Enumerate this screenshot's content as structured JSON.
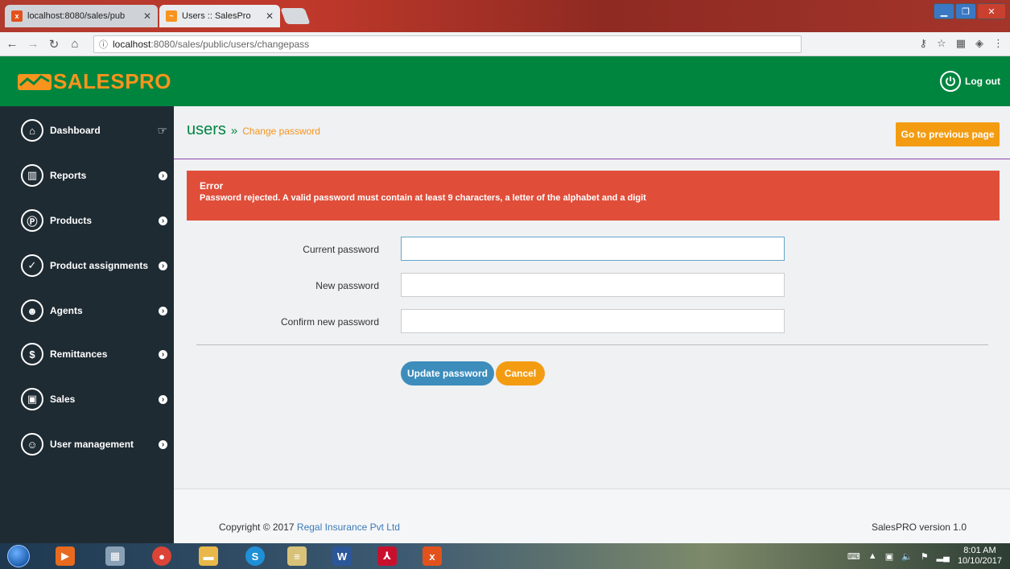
{
  "browser": {
    "tabs": [
      {
        "title": "localhost:8080/sales/pub",
        "active": false
      },
      {
        "title": "Users :: SalesPro",
        "active": true
      }
    ],
    "url_host": "localhost",
    "url_rest": ":8080/sales/public/users/changepass",
    "info_icon": "ⓘ"
  },
  "header": {
    "brand_part1": "SALES",
    "brand_part2": "PRO",
    "logout_label": "Log out"
  },
  "sidebar": {
    "items": [
      {
        "label": "Dashboard",
        "icon": "home-icon"
      },
      {
        "label": "Reports",
        "icon": "chart-icon"
      },
      {
        "label": "Products",
        "icon": "product-icon"
      },
      {
        "label": "Product assignments",
        "icon": "check-icon"
      },
      {
        "label": "Agents",
        "icon": "agents-icon"
      },
      {
        "label": "Remittances",
        "icon": "dollar-icon"
      },
      {
        "label": "Sales",
        "icon": "cash-icon"
      },
      {
        "label": "User management",
        "icon": "user-icon"
      }
    ]
  },
  "main": {
    "breadcrumb_root": "users",
    "breadcrumb_sep": "»",
    "breadcrumb_leaf": "Change password",
    "prev_button": "Go to previous page",
    "alert_title": "Error",
    "alert_message": "Password rejected. A valid password must contain at least 9 characters, a letter of the alphabet and a digit",
    "fields": {
      "current_label": "Current password",
      "current_value": "",
      "new_label": "New password",
      "new_value": "",
      "confirm_label": "Confirm new password",
      "confirm_value": ""
    },
    "update_button": "Update password",
    "cancel_button": "Cancel"
  },
  "footer": {
    "copy_prefix": "Copyright © 2017 ",
    "company": "Regal Insurance Pvt Ltd",
    "version": "SalesPRO version 1.0"
  },
  "taskbar": {
    "time": "8:01 AM",
    "date": "10/10/2017"
  },
  "colors": {
    "header_green": "#00853f",
    "sidebar_dark": "#1f2b33",
    "accent_orange": "#f39c12",
    "alert_red": "#e04e3a",
    "primary_blue": "#3c8dbc"
  }
}
